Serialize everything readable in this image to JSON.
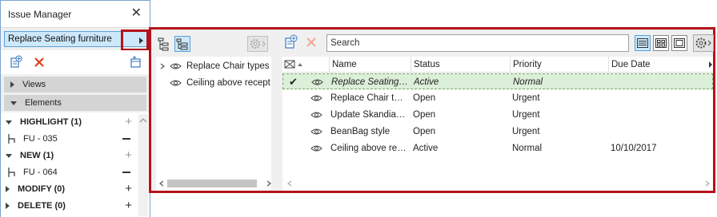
{
  "palette": {
    "title": "Issue Manager",
    "selected_issue": "Replace Seating furniture",
    "sections": {
      "views": "Views",
      "elements": "Elements"
    },
    "groups": [
      {
        "label": "HIGHLIGHT (1)",
        "element": "FU - 035"
      },
      {
        "label": "NEW (1)",
        "element": "FU - 064"
      },
      {
        "label": "MODIFY (0)"
      },
      {
        "label": "DELETE (0)"
      }
    ]
  },
  "tree": {
    "items": [
      {
        "label": "Replace Chair types"
      },
      {
        "label": "Ceiling above recept"
      }
    ]
  },
  "search": {
    "placeholder": "Search"
  },
  "table": {
    "columns": [
      "Name",
      "Status",
      "Priority",
      "Due Date"
    ],
    "rows": [
      {
        "name": "Replace Seating furniture",
        "status": "Active",
        "priority": "Normal",
        "due": "",
        "checked": true
      },
      {
        "name": "Replace Chair types",
        "status": "Open",
        "priority": "Urgent",
        "due": ""
      },
      {
        "name": "Update Skandia chairs",
        "status": "Open",
        "priority": "Urgent",
        "due": ""
      },
      {
        "name": "BeanBag style",
        "status": "Open",
        "priority": "Urgent",
        "due": ""
      },
      {
        "name": "Ceiling above reception",
        "status": "Active",
        "priority": "Normal",
        "due": "10/10/2017"
      }
    ]
  },
  "colors": {
    "highlight_border": "#b5121b",
    "selection": "#cde8fb",
    "selected_row": "#dcefd8",
    "delete_x": "#e0401c"
  }
}
